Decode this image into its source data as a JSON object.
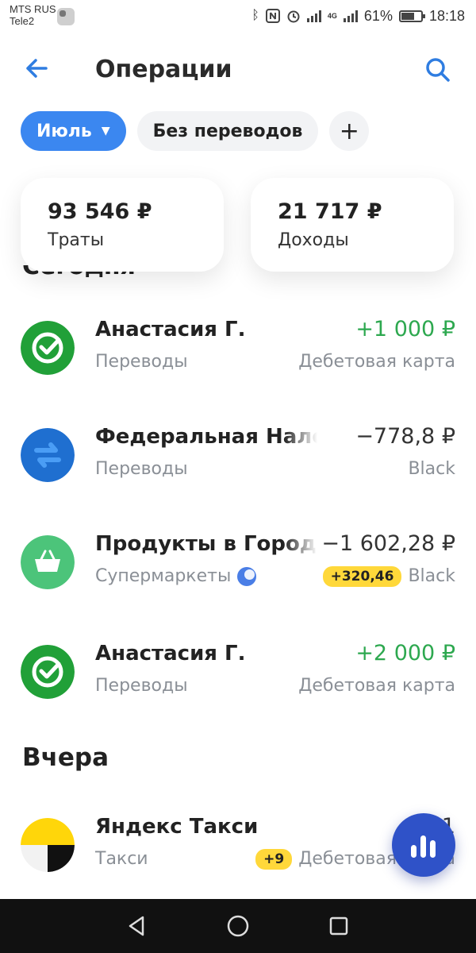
{
  "status_bar": {
    "carrier_1": "MTS RUS",
    "carrier_2": "Tele2",
    "network": "4G",
    "battery": "61%",
    "battery_level": 0.61,
    "time": "18:18"
  },
  "header": {
    "title": "Операции"
  },
  "filters": {
    "month": "Июль",
    "filter_label": "Без переводов",
    "add_label": "+"
  },
  "summary": {
    "spent_amount": "93 546 ₽",
    "spent_label": "Траты",
    "income_amount": "21 717 ₽",
    "income_label": "Доходы"
  },
  "sections": {
    "today_partial": "Сегодня",
    "yesterday": "Вчера"
  },
  "transactions": [
    {
      "name": "Анастасия Г.",
      "category": "Переводы",
      "amount": "+1 000 ₽",
      "account": "Дебетовая карта",
      "icon": "sber-check-icon",
      "color": "#21a038"
    },
    {
      "name": "Федеральная Налоговая служба",
      "category": "Переводы",
      "amount": "−778,8 ₽",
      "account": "Black",
      "icon": "transfer-arrows-icon",
      "color": "#1f6fd0"
    },
    {
      "name": "Продукты в Городе",
      "category": "Супермаркеты",
      "amount": "−1 602,28 ₽",
      "cashback": "+320,46",
      "account": "Black",
      "icon": "basket-icon",
      "color": "#4cc47a"
    },
    {
      "name": "Анастасия Г.",
      "category": "Переводы",
      "amount": "+2 000 ₽",
      "account": "Дебетовая карта",
      "icon": "sber-check-icon",
      "color": "#21a038"
    },
    {
      "name": "Яндекс Такси",
      "category": "Такси",
      "amount": "−1",
      "cashback": "+9",
      "account": "Дебетовая карта",
      "icon": "yandex-taxi-icon",
      "color": "#ffd60a"
    }
  ],
  "colors": {
    "accent": "#3b87f0",
    "positive": "#2da84f",
    "secondary_text": "#8a8f96",
    "cashback_badge": "#ffd83a",
    "fab": "#2f52c8"
  }
}
